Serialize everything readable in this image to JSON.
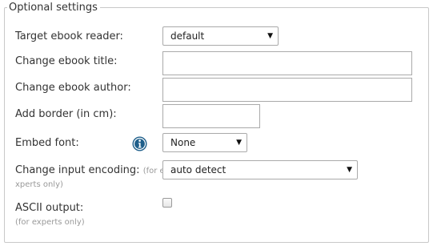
{
  "section": {
    "legend": "Optional settings"
  },
  "fields": {
    "target_reader": {
      "label": "Target ebook reader:",
      "value": "default"
    },
    "title": {
      "label": "Change ebook title:",
      "value": ""
    },
    "author": {
      "label": "Change ebook author:",
      "value": ""
    },
    "border": {
      "label": "Add border (in cm):",
      "value": ""
    },
    "embed_font": {
      "label": "Embed font:",
      "value": "None",
      "info_icon": "info-icon"
    },
    "input_encoding": {
      "label": "Change input encoding:",
      "hint_line1": "(for e",
      "hint_line2": "xperts only)",
      "value": "auto detect"
    },
    "ascii_output": {
      "label": "ASCII output:",
      "hint": "(for experts only)",
      "checked": false
    }
  },
  "icons": {
    "dropdown": "chevron-down-icon",
    "info": "info-icon"
  },
  "colors": {
    "info_icon": "#1f5f8b",
    "border": "#c8c8c8",
    "hint_text": "#999999"
  }
}
